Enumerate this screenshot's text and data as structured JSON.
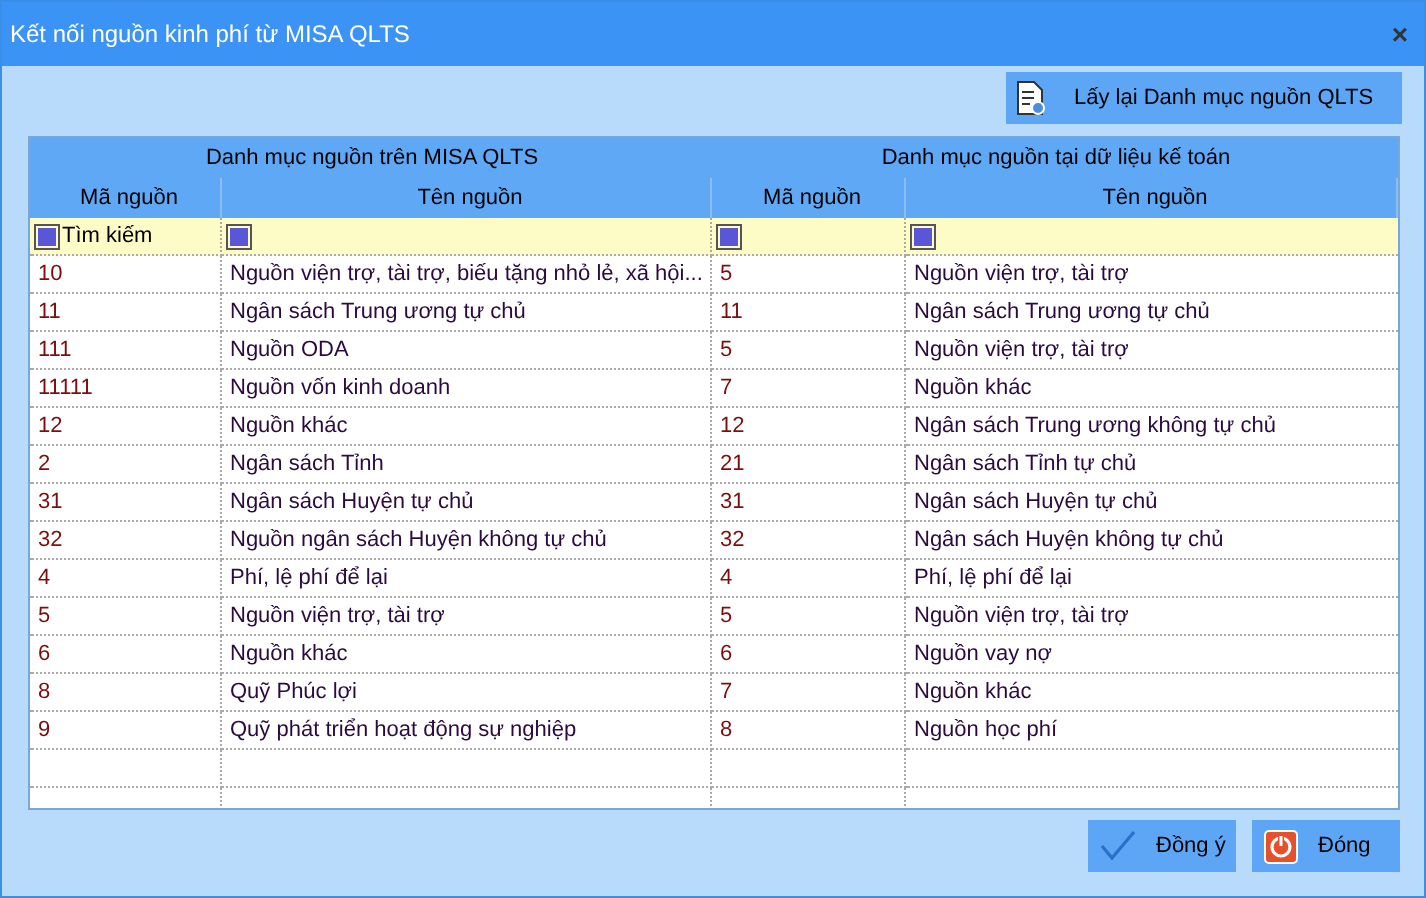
{
  "window": {
    "title": "Kết nối nguồn kinh phí từ MISA QLTS",
    "close": "×"
  },
  "reload_button": {
    "label": "Lấy lại Danh mục nguồn QLTS"
  },
  "table": {
    "groups": [
      "Danh mục nguồn trên MISA QLTS",
      "Danh mục nguồn tại dữ liệu kế toán"
    ],
    "columns": [
      "Mã nguồn",
      "Tên nguồn",
      "Mã nguồn",
      "Tên nguồn"
    ],
    "filter": {
      "placeholder": "Tìm kiếm"
    },
    "rows": [
      [
        "10",
        "Nguồn viện trợ, tài trợ, biếu tặng nhỏ lẻ, xã hội...",
        "5",
        "Nguồn viện trợ, tài trợ"
      ],
      [
        "11",
        "Ngân sách Trung ương tự chủ",
        "11",
        "Ngân sách Trung ương tự chủ"
      ],
      [
        "111",
        "Nguồn ODA",
        "5",
        "Nguồn viện trợ, tài trợ"
      ],
      [
        "11111",
        "Nguồn vốn kinh doanh",
        "7",
        "Nguồn khác"
      ],
      [
        "12",
        "Nguồn khác",
        "12",
        "Ngân sách Trung ương không tự chủ"
      ],
      [
        "2",
        "Ngân sách Tỉnh",
        "21",
        "Ngân sách Tỉnh tự chủ"
      ],
      [
        "31",
        "Ngân sách Huyện tự chủ",
        "31",
        "Ngân sách Huyện tự chủ"
      ],
      [
        "32",
        "Nguồn ngân sách Huyện không tự chủ",
        "32",
        "Ngân sách Huyện không tự chủ"
      ],
      [
        "4",
        "Phí, lệ phí để lại",
        "4",
        "Phí, lệ phí để lại"
      ],
      [
        "5",
        "Nguồn viện trợ, tài trợ",
        "5",
        "Nguồn viện trợ, tài trợ"
      ],
      [
        "6",
        "Nguồn khác",
        "6",
        "Nguồn vay nợ"
      ],
      [
        "8",
        "Quỹ Phúc lợi",
        "7",
        "Nguồn khác"
      ],
      [
        "9",
        "Quỹ phát triển hoạt động sự nghiệp",
        "8",
        "Nguồn học phí"
      ]
    ]
  },
  "buttons": [
    {
      "kind": "ok",
      "label": "Đồng ý"
    },
    {
      "kind": "close",
      "label": "Đóng"
    }
  ]
}
